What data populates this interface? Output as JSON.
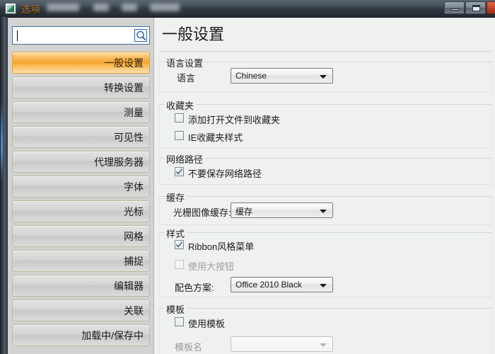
{
  "window": {
    "title": "选项",
    "icon": "options-app-icon",
    "buttons": {
      "minimize": "minimize-icon",
      "maximize": "maximize-icon",
      "close": "close-icon"
    }
  },
  "sidebar": {
    "search": {
      "value": "",
      "placeholder": "",
      "icon": "search-icon"
    },
    "items": [
      {
        "label": "一般设置",
        "selected": true
      },
      {
        "label": "转换设置",
        "selected": false
      },
      {
        "label": "测量",
        "selected": false
      },
      {
        "label": "可见性",
        "selected": false
      },
      {
        "label": "代理服务器",
        "selected": false
      },
      {
        "label": "字体",
        "selected": false
      },
      {
        "label": "光标",
        "selected": false
      },
      {
        "label": "网格",
        "selected": false
      },
      {
        "label": "捕捉",
        "selected": false
      },
      {
        "label": "编辑器",
        "selected": false
      },
      {
        "label": "关联",
        "selected": false
      },
      {
        "label": "加载中/保存中",
        "selected": false
      }
    ]
  },
  "main": {
    "title": "一般设置",
    "groups": {
      "language": {
        "legend": "语言设置",
        "label": "语言",
        "value": "Chinese"
      },
      "favorites": {
        "legend": "收藏夹",
        "check_add_open_file": "添加打开文件到收藏夹",
        "check_ie_style": "IE收藏夹样式"
      },
      "network": {
        "legend": "网络路径",
        "check_no_save": "不要保存网络路径"
      },
      "cache": {
        "legend": "缓存",
        "label": "光栅图像缓存:",
        "value": "缓存"
      },
      "style": {
        "legend": "样式",
        "check_ribbon": "Ribbon风格菜单",
        "check_big_buttons": "使用大按钮",
        "scheme_label": "配色方案:",
        "scheme_value": "Office 2010 Black"
      },
      "template": {
        "legend": "模板",
        "check_use_template": "使用模板",
        "name_label": "模板名",
        "name_value": ""
      }
    }
  },
  "colors": {
    "accent_orange": "#f6a429",
    "title_text": "#c9782a",
    "sidebar_bg": "#d2d2d2",
    "panel_bg": "#eff0f0",
    "close_red": "#c4452a"
  }
}
